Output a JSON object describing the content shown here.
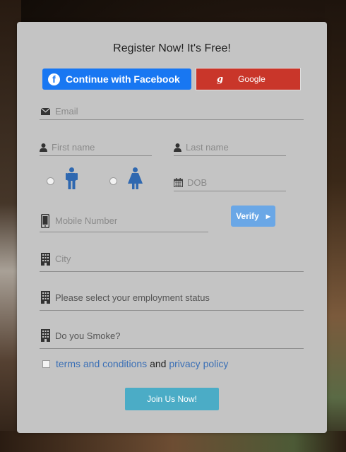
{
  "form": {
    "title": "Register Now! It's Free!",
    "facebook_label": "Continue with Facebook",
    "facebook_glyph": "f",
    "google_label": "Google",
    "google_glyph": "g",
    "email_placeholder": "Email",
    "first_name_placeholder": "First name",
    "last_name_placeholder": "Last name",
    "dob_placeholder": "DOB",
    "mobile_placeholder": "Mobile Number",
    "verify_label": "Verify",
    "city_placeholder": "City",
    "employment_placeholder": "Please select your employment status",
    "smoke_placeholder": "Do you Smoke?",
    "terms_link": "terms and conditions",
    "terms_and": " and ",
    "privacy_link": "privacy policy",
    "join_label": "Join Us Now!"
  },
  "icons": {
    "email": "envelope-icon",
    "name": "user-icon",
    "dob": "calendar-icon",
    "mobile": "mobile-phone-icon",
    "building": "building-icon",
    "male": "male-icon",
    "female": "female-icon"
  },
  "colors": {
    "facebook": "#1877f2",
    "google": "#c9362a",
    "verify": "#6aa7e6",
    "join": "#4bacc6",
    "link": "#3a6fb5",
    "gender_icon": "#2f68b0"
  }
}
